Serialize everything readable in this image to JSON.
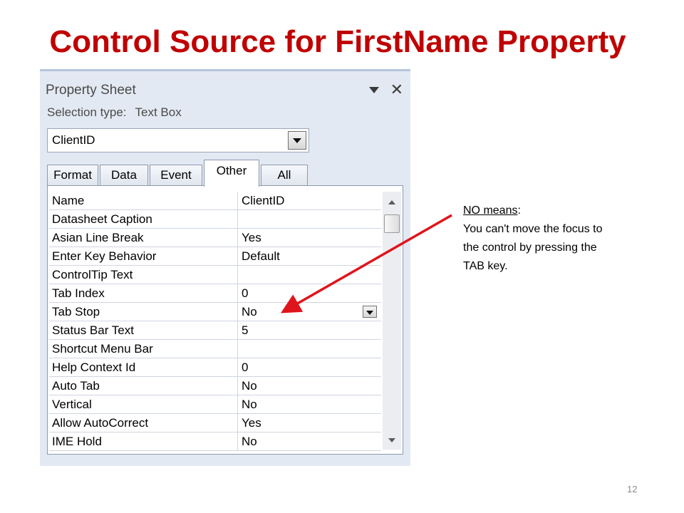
{
  "slide": {
    "title": "Control Source for FirstName Property",
    "page_number": "12"
  },
  "property_sheet": {
    "title": "Property Sheet",
    "selection_type_label": "Selection type:",
    "selection_type_value": "Text Box",
    "object_selector_value": "ClientID",
    "tabs": [
      {
        "label": "Format",
        "active": false
      },
      {
        "label": "Data",
        "active": false
      },
      {
        "label": "Event",
        "active": false
      },
      {
        "label": "Other",
        "active": true
      },
      {
        "label": "All",
        "active": false
      }
    ],
    "properties": [
      {
        "name": "Name",
        "value": "ClientID"
      },
      {
        "name": "Datasheet Caption",
        "value": ""
      },
      {
        "name": "Asian Line Break",
        "value": "Yes"
      },
      {
        "name": "Enter Key Behavior",
        "value": "Default"
      },
      {
        "name": "ControlTip Text",
        "value": ""
      },
      {
        "name": "Tab Index",
        "value": "0"
      },
      {
        "name": "Tab Stop",
        "value": "No"
      },
      {
        "name": "Status Bar Text",
        "value": "5"
      },
      {
        "name": "Shortcut Menu Bar",
        "value": ""
      },
      {
        "name": "Help Context Id",
        "value": "0"
      },
      {
        "name": "Auto Tab",
        "value": "No"
      },
      {
        "name": "Vertical",
        "value": "No"
      },
      {
        "name": "Allow AutoCorrect",
        "value": "Yes"
      },
      {
        "name": "IME Hold",
        "value": "No"
      }
    ]
  },
  "annotation": {
    "heading": "NO means",
    "heading_suffix": ":",
    "body": "You can't move the focus to the control by pressing the TAB key."
  },
  "colors": {
    "title": "#c00000",
    "arrow": "#e0141b"
  }
}
